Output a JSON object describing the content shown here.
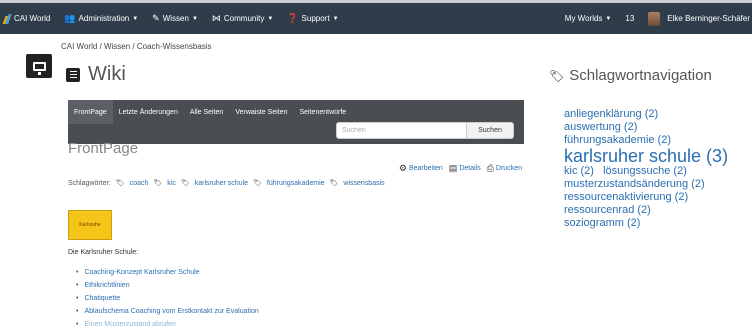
{
  "topnav": {
    "brand": "CAI World",
    "items": [
      {
        "label": "Administration",
        "icon": "people-icon"
      },
      {
        "label": "Wissen",
        "icon": "book-icon"
      },
      {
        "label": "Community",
        "icon": "community-icon"
      },
      {
        "label": "Support",
        "icon": "help-icon"
      }
    ],
    "my_worlds": "My Worlds",
    "notifications": "13",
    "user": "Elke Berninger-Schäfer"
  },
  "breadcrumb": "CAI World / Wissen / Coach-Wissensbasis",
  "wiki": {
    "title": "Wiki",
    "tabs": [
      {
        "label": "FrontPage",
        "active": true
      },
      {
        "label": "Letzte Änderungen",
        "active": false
      },
      {
        "label": "Alle Seiten",
        "active": false
      },
      {
        "label": "Verwaiste Seiten",
        "active": false
      },
      {
        "label": "Seitenentwürfe",
        "active": false
      }
    ],
    "search": {
      "placeholder": "Suchen",
      "button": "Suchen"
    },
    "page_heading": "FrontPage",
    "actions": [
      {
        "label": "Bearbeiten",
        "icon": "gear-icon"
      },
      {
        "label": "Details",
        "icon": "details-icon"
      },
      {
        "label": "Drucken",
        "icon": "print-icon"
      }
    ],
    "tags_label": "Schlagwörter:",
    "tags": [
      "coach",
      "kic",
      "karlsruher schule",
      "führungsakademie",
      "wissensbasis"
    ],
    "badge": "Karlsruhe",
    "intro": "Die Karlsruher Schule:",
    "links": [
      "Coaching-Konzept Karlsruher Schule",
      "Ethikrichtlinien",
      "Chatiquette",
      "Ablaufschema Coaching vom Erstkontakt zur Evaluation",
      "Einen Musterzustand abrufen"
    ]
  },
  "tag_nav": {
    "title": "Schlagwortnavigation",
    "tags": [
      {
        "label": "anliegenklärung (2)",
        "size": "normal"
      },
      {
        "label": "auswertung (2)",
        "size": "normal"
      },
      {
        "label": "führungsakademie (2)",
        "size": "normal"
      },
      {
        "label": "karlsruher schule (3)",
        "size": "large"
      },
      {
        "label": "kic (2)   lösungssuche (2)",
        "size": "normal"
      },
      {
        "label": "musterzustandsänderung (2)",
        "size": "normal"
      },
      {
        "label": "ressourcenaktivierung (2)",
        "size": "normal"
      },
      {
        "label": "ressourcenrad (2)",
        "size": "normal"
      },
      {
        "label": "soziogramm (2)",
        "size": "normal"
      }
    ]
  }
}
